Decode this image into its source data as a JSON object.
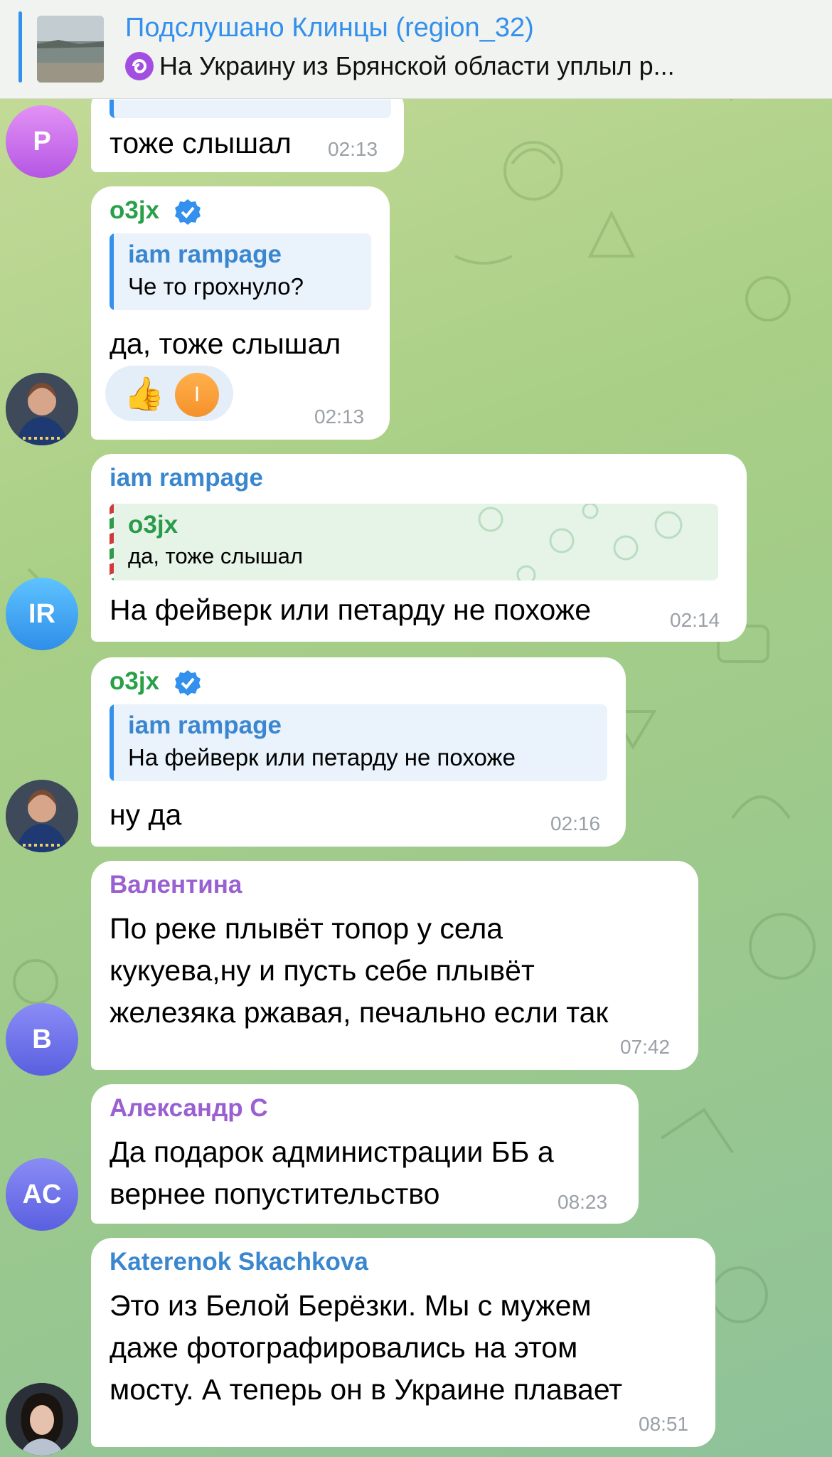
{
  "colors": {
    "accent": "#3390ec",
    "green_name": "#27a048",
    "blue_name": "#3a87cf",
    "purple_name": "#9a5fd0"
  },
  "pinned": {
    "title": "Подслушано Клинцы (region_32)",
    "text": "На Украину из Брянской области уплыл р..."
  },
  "messages": [
    {
      "text": "тоже слышал",
      "time": "02:13"
    },
    {
      "sender": "o3jx",
      "reply_name": "iam rampage",
      "reply_text": "Че то грохнуло?",
      "text": "да, тоже слышал",
      "time": "02:13",
      "reaction_initial": "I"
    },
    {
      "sender": "iam rampage",
      "reply_name": "o3jx",
      "reply_text": "да, тоже слышал",
      "text": "На фейверк или петарду не похоже",
      "time": "02:14"
    },
    {
      "sender": "o3jx",
      "reply_name": "iam rampage",
      "reply_text": "На фейверк или петарду не похоже",
      "text": "ну да",
      "time": "02:16"
    },
    {
      "sender": "Валентина",
      "lines": [
        "По реке плывёт топор у села",
        "кукуева,ну и пусть себе плывёт",
        "железяка ржавая, печально если так"
      ],
      "time": "07:42"
    },
    {
      "sender": "Александр С",
      "lines": [
        "Да подарок администрации ББ а",
        "вернее попустительство"
      ],
      "time": "08:23"
    },
    {
      "sender": "Katerenok Skachkova",
      "lines": [
        "Это из Белой Берёзки. Мы с мужем",
        "даже фотографировались на этом",
        "мосту. А теперь он в Украине плавает"
      ],
      "time": "08:51"
    }
  ],
  "avatars": {
    "p": "P",
    "ir": "IR",
    "b": "B",
    "ac": "AC"
  }
}
